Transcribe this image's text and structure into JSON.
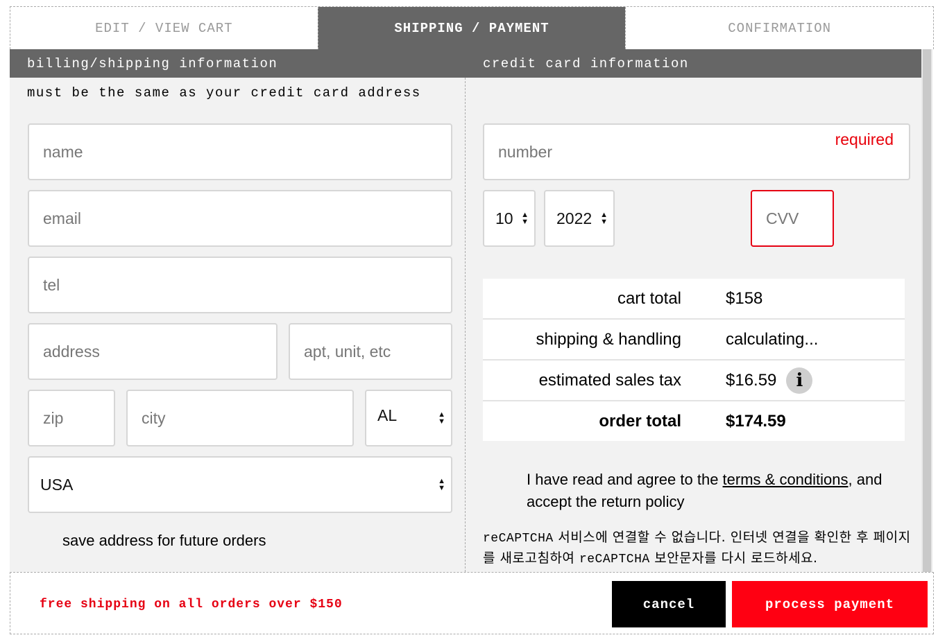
{
  "tabs": [
    {
      "label": "EDIT / VIEW CART",
      "active": false
    },
    {
      "label": "SHIPPING / PAYMENT",
      "active": true
    },
    {
      "label": "CONFIRMATION",
      "active": false
    }
  ],
  "billing": {
    "header": "billing/shipping information",
    "note": "must be the same as your credit card address",
    "name_placeholder": "name",
    "email_placeholder": "email",
    "tel_placeholder": "tel",
    "address_placeholder": "address",
    "apt_placeholder": "apt, unit, etc",
    "zip_placeholder": "zip",
    "city_placeholder": "city",
    "state_value": "AL",
    "country_value": "USA",
    "save_label": "save address for future orders"
  },
  "card": {
    "header": "credit card information",
    "number_placeholder": "number",
    "required_label": "required",
    "month_value": "10",
    "year_value": "2022",
    "cvv_placeholder": "CVV"
  },
  "totals": {
    "cart_total_label": "cart total",
    "cart_total_value": "$158",
    "shipping_label": "shipping & handling",
    "shipping_value": "calculating...",
    "tax_label": "estimated sales tax",
    "tax_value": "$16.59",
    "info_icon": "i",
    "order_total_label": "order total",
    "order_total_value": "$174.59"
  },
  "agreement": {
    "prefix": "I have read and agree to the ",
    "link": "terms & conditions",
    "suffix": ", and accept the return policy"
  },
  "recaptcha": {
    "part1": "reCAPTCHA",
    "part2": " 서비스에 연결할 수 없습니다. 인터넷 연결을 확인한 후 페이지를 새로고침하여 ",
    "part3": "reCAPTCHA",
    "part4": " 보안문자를 다시 로드하세요."
  },
  "footer": {
    "free_shipping": "free shipping on all orders over $150",
    "cancel_label": "cancel",
    "process_label": "process payment"
  },
  "colors": {
    "tab_active_bg": "#666666",
    "panel_bg": "#f2f2f2",
    "accent_red": "#ff0012",
    "cancel_bg": "#000000"
  },
  "icons": {
    "select_arrows": "select-arrows-icon",
    "info": "info-icon"
  }
}
